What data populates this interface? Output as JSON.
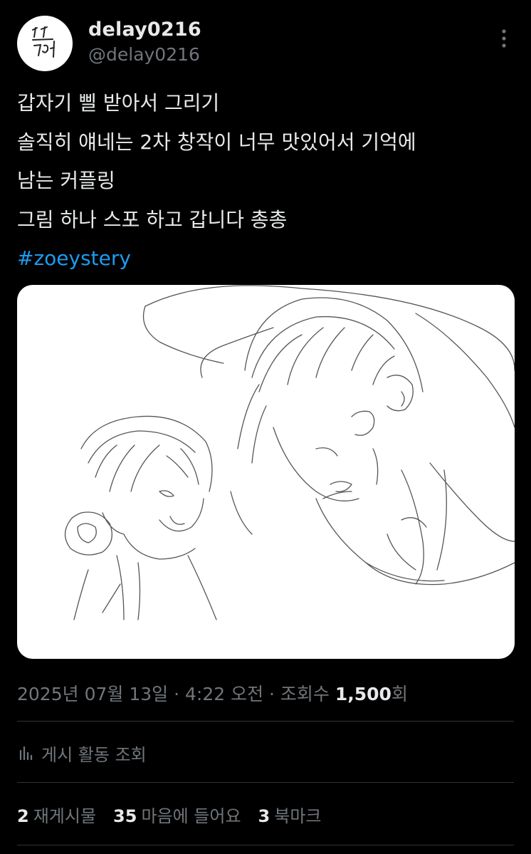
{
  "user": {
    "display_name": "delay0216",
    "handle": "@delay0216"
  },
  "tweet": {
    "lines": [
      "갑자기 삘 받아서 그리기",
      "솔직히 얘네는 2차 창작이 너무 맛있어서 기억에",
      "남는 커플링",
      "그림 하나 스포 하고 갑니다 총총"
    ],
    "hashtag": "#zoeystery"
  },
  "meta": {
    "date": "2025년 07월 13일",
    "separator": " · ",
    "time": "4:22 오전",
    "views_label": "조회수 ",
    "views_count": "1,500",
    "views_suffix": "회"
  },
  "activity": {
    "label": "게시 활동 조회"
  },
  "stats": {
    "reposts_count": "2",
    "reposts_label": "재게시물",
    "likes_count": "35",
    "likes_label": "마음에 들어요",
    "bookmarks_count": "3",
    "bookmarks_label": "북마크"
  },
  "colors": {
    "background": "#000000",
    "text_primary": "#e7e9ea",
    "text_secondary": "#71767b",
    "link": "#1d9bf0",
    "divider": "#2f3336"
  },
  "icons": {
    "avatar": "handwritten-avatar",
    "more": "vertical-ellipsis-icon",
    "activity": "bar-chart-icon"
  }
}
